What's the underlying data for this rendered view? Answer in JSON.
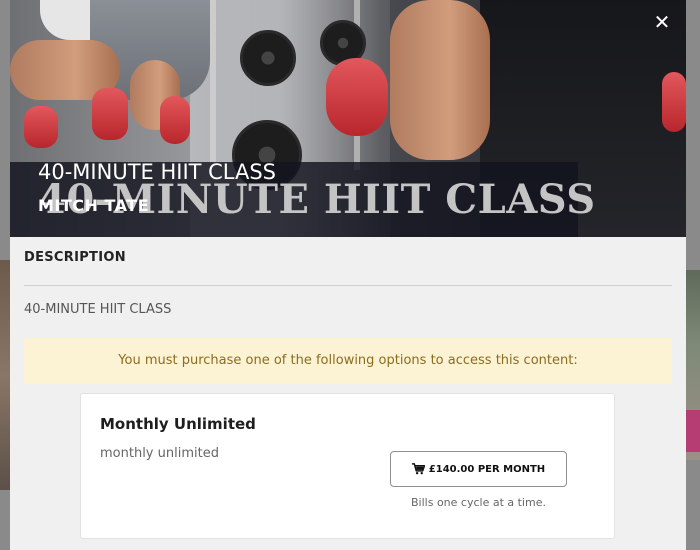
{
  "modal": {
    "close_symbol": "✕",
    "hero": {
      "title": "40-MINUTE HIIT CLASS",
      "banner_title": "40-MINUTE HIIT CLASS",
      "instructor": "MITCH TATE"
    },
    "description": {
      "heading": "DESCRIPTION",
      "text": "40-MINUTE HIIT CLASS"
    },
    "notice": "You must purchase one of the following options to access this content:",
    "options": [
      {
        "name": "Monthly Unlimited",
        "description": "monthly unlimited",
        "button_label": "£140.00 PER MONTH",
        "billing_note": "Bills one cycle at a time."
      }
    ]
  },
  "colors": {
    "notice_bg": "#fcf2d4",
    "notice_text": "#8a6d1f",
    "overlay": "#7a7a7a"
  },
  "icons": {
    "close": "close-icon",
    "cart": "cart-icon"
  }
}
